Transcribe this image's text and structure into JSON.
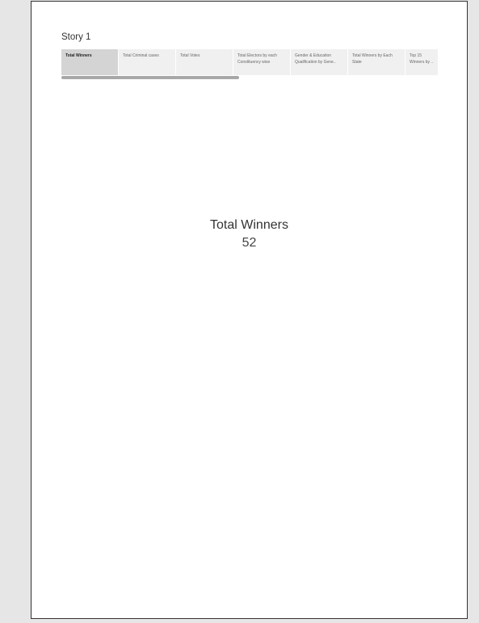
{
  "story": {
    "title": "Story 1",
    "tabs": [
      {
        "label": "Total Winners",
        "active": true
      },
      {
        "label": "Total Criminal cases",
        "active": false
      },
      {
        "label": "Total Votes",
        "active": false
      },
      {
        "label": "Total Electors by each Constituency wise",
        "active": false
      },
      {
        "label": "Gender & Education Qualification by Gene..",
        "active": false
      },
      {
        "label": "Total Winners by Each State",
        "active": false
      },
      {
        "label": "Top 15 Winners by ..",
        "active": false
      }
    ]
  },
  "kpi": {
    "label": "Total Winners",
    "value": "52"
  }
}
